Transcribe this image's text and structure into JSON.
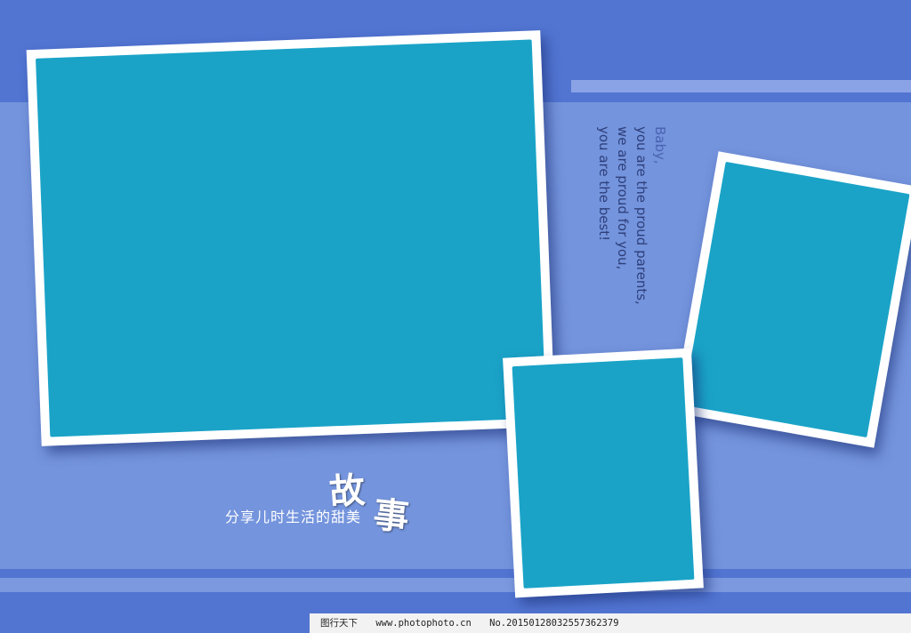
{
  "colors": {
    "background": "#7494dd",
    "band": "#5275d2",
    "photo_placeholder": "#1aa3c7",
    "frame": "#ffffff",
    "text_dark": "#2e3f7a"
  },
  "vertical_text": {
    "line1": "Baby,",
    "line2": "you are the proud parents,",
    "line3": "we are proud for you,",
    "line4": "you are the best!"
  },
  "caption": {
    "small": "分享儿时生活的甜美",
    "big_char_1": "故",
    "big_char_2": "事"
  },
  "watermark": {
    "site_name": "图行天下",
    "url": "www.photophoto.cn",
    "number": "No.20150128032557362379"
  }
}
